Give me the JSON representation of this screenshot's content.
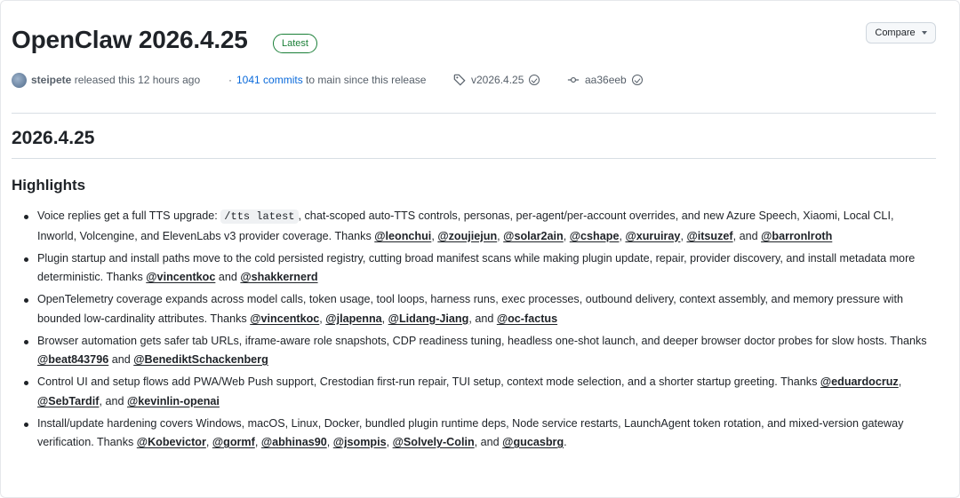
{
  "release": {
    "title": "OpenClaw 2026.4.25",
    "latest_badge": "Latest",
    "compare_label": "Compare",
    "author": "steipete",
    "released_text": "released this 12 hours ago",
    "commits_link": "1041 commits",
    "commits_suffix": "to main since this release",
    "tag": "v2026.4.25",
    "commit_hash": "aa36eeb"
  },
  "body": {
    "version_heading": "2026.4.25",
    "highlights_heading": "Highlights",
    "common": {
      "thanks": "Thanks",
      "and": "and"
    },
    "items": [
      {
        "prefix": "Voice replies get a full TTS upgrade:",
        "code": "/tts latest",
        "text": ", chat-scoped auto-TTS controls, personas, per-agent/per-account overrides, and new Azure Speech, Xiaomi, Local CLI, Inworld, Volcengine, and ElevenLabs v3 provider coverage.",
        "mentions": [
          "@leonchui",
          "@zoujiejun",
          "@solar2ain",
          "@cshape",
          "@xuruiray",
          "@itsuzef",
          "@barronlroth"
        ]
      },
      {
        "text": "Plugin startup and install paths move to the cold persisted registry, cutting broad manifest scans while making plugin update, repair, provider discovery, and install metadata more deterministic.",
        "mentions": [
          "@vincentkoc",
          "@shakkernerd"
        ]
      },
      {
        "text": "OpenTelemetry coverage expands across model calls, token usage, tool loops, harness runs, exec processes, outbound delivery, context assembly, and memory pressure with bounded low-cardinality attributes.",
        "mentions": [
          "@vincentkoc",
          "@jlapenna",
          "@Lidang-Jiang",
          "@oc-factus"
        ]
      },
      {
        "text": "Browser automation gets safer tab URLs, iframe-aware role snapshots, CDP readiness tuning, headless one-shot launch, and deeper browser doctor probes for slow hosts.",
        "mentions": [
          "@beat843796",
          "@BenediktSchackenberg"
        ]
      },
      {
        "text": "Control UI and setup flows add PWA/Web Push support, Crestodian first-run repair, TUI setup, context mode selection, and a shorter startup greeting.",
        "mentions": [
          "@eduardocruz",
          "@SebTardif",
          "@kevinlin-openai"
        ]
      },
      {
        "text": "Install/update hardening covers Windows, macOS, Linux, Docker, bundled plugin runtime deps, Node service restarts, LaunchAgent token rotation, and mixed-version gateway verification.",
        "mentions": [
          "@Kobevictor",
          "@gormf",
          "@abhinas90",
          "@jsompis",
          "@Solvely-Colin",
          "@gucasbrg"
        ]
      }
    ]
  }
}
